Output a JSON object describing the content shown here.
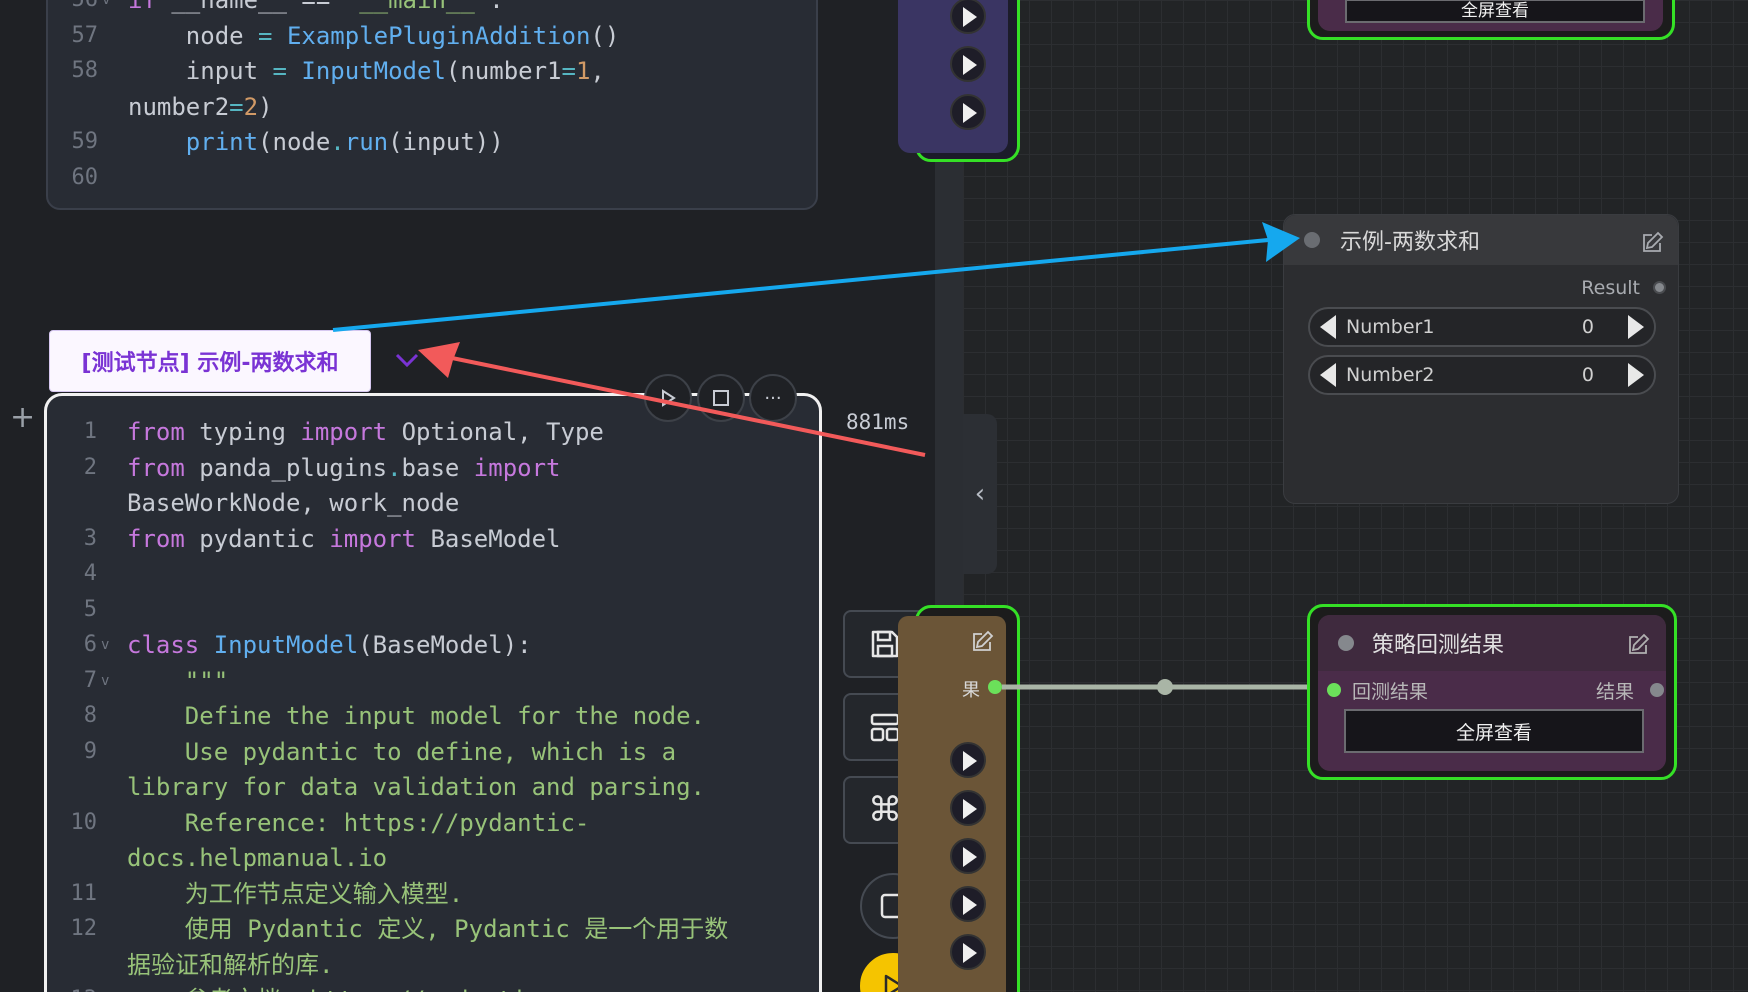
{
  "editor": {
    "top_cell_lines": [
      {
        "n": "56",
        "fold": "v",
        "parts": [
          [
            "kw",
            "if "
          ],
          [
            "plain",
            "__name__ == "
          ],
          [
            "str",
            "\"__main__\""
          ],
          [
            "plain",
            ":"
          ]
        ]
      },
      {
        "n": "57",
        "parts": [
          [
            "plain",
            "    node "
          ],
          [
            "op",
            "= "
          ],
          [
            "fn",
            "ExamplePluginAddition"
          ],
          [
            "plain",
            "()"
          ]
        ]
      },
      {
        "n": "58",
        "parts": [
          [
            "plain",
            "    input "
          ],
          [
            "op",
            "= "
          ],
          [
            "fn",
            "InputModel"
          ],
          [
            "plain",
            "(number1"
          ],
          [
            "op",
            "="
          ],
          [
            "num",
            "1"
          ],
          [
            "plain",
            ","
          ]
        ]
      },
      {
        "n": "",
        "parts": [
          [
            "plain",
            "number2"
          ],
          [
            "op",
            "="
          ],
          [
            "num",
            "2"
          ],
          [
            "plain",
            ")"
          ]
        ]
      },
      {
        "n": "59",
        "parts": [
          [
            "plain",
            "    "
          ],
          [
            "fn",
            "print"
          ],
          [
            "plain",
            "(node"
          ],
          [
            "op",
            "."
          ],
          [
            "fn",
            "run"
          ],
          [
            "plain",
            "(input))"
          ]
        ]
      },
      {
        "n": "60",
        "parts": []
      }
    ],
    "main_cell_lines": [
      {
        "n": "1",
        "parts": [
          [
            "kw",
            "from "
          ],
          [
            "plain",
            "typing "
          ],
          [
            "kw",
            "import "
          ],
          [
            "plain",
            "Optional, Type"
          ]
        ]
      },
      {
        "n": "2",
        "parts": [
          [
            "kw",
            "from "
          ],
          [
            "plain",
            "panda_plugins"
          ],
          [
            "op",
            "."
          ],
          [
            "plain",
            "base "
          ],
          [
            "kw",
            "import"
          ]
        ]
      },
      {
        "n": "",
        "parts": [
          [
            "plain",
            "BaseWorkNode, work_node"
          ]
        ]
      },
      {
        "n": "3",
        "parts": [
          [
            "kw",
            "from "
          ],
          [
            "plain",
            "pydantic "
          ],
          [
            "kw",
            "import "
          ],
          [
            "plain",
            "BaseModel"
          ]
        ]
      },
      {
        "n": "4",
        "parts": []
      },
      {
        "n": "5",
        "parts": []
      },
      {
        "n": "6",
        "fold": "v",
        "parts": [
          [
            "kw",
            "class "
          ],
          [
            "fn",
            "InputModel"
          ],
          [
            "plain",
            "(BaseModel):"
          ]
        ]
      },
      {
        "n": "7",
        "fold": "v",
        "parts": [
          [
            "str",
            "    \"\"\""
          ]
        ]
      },
      {
        "n": "8",
        "parts": [
          [
            "str",
            "    Define the input model for the node."
          ]
        ]
      },
      {
        "n": "9",
        "parts": [
          [
            "str",
            "    Use pydantic to define, which is a"
          ]
        ]
      },
      {
        "n": "",
        "parts": [
          [
            "str",
            "library for data validation and parsing."
          ]
        ]
      },
      {
        "n": "10",
        "parts": [
          [
            "str",
            "    Reference: https://pydantic-"
          ]
        ]
      },
      {
        "n": "",
        "parts": [
          [
            "str",
            "docs.helpmanual.io"
          ]
        ]
      },
      {
        "n": "11",
        "parts": [
          [
            "str",
            "    为工作节点定义输入模型."
          ]
        ]
      },
      {
        "n": "12",
        "parts": [
          [
            "str",
            "    使用 Pydantic 定义, Pydantic 是一个用于数"
          ]
        ]
      },
      {
        "n": "",
        "parts": [
          [
            "str",
            "据验证和解析的库."
          ]
        ]
      },
      {
        "n": "13",
        "parts": [
          [
            "str",
            "    参考文档: https://pydantic-"
          ]
        ]
      }
    ],
    "node_tab_label": "[测试节点] 示例-两数求和",
    "timing": "881ms",
    "icons": {
      "chevron": "chevron-down-icon",
      "run": "play-icon",
      "stop": "stop-icon",
      "more": "more-icon",
      "add": "plus-icon",
      "save": "save-icon",
      "layout": "layout-icon",
      "command": "command-icon",
      "stop_all": "stop-square-icon",
      "run_all": "play-icon"
    }
  },
  "canvas": {
    "sum_node": {
      "title": "示例-两数求和",
      "output_label": "Result",
      "fields": [
        {
          "label": "Number1",
          "value": "0"
        },
        {
          "label": "Number2",
          "value": "0"
        }
      ]
    },
    "backtest_node": {
      "title": "策略回测结果",
      "input_label": "回测结果",
      "output_label": "结果",
      "button": "全屏查看"
    },
    "top_node_button": "全屏查看",
    "left_stub_label": "果"
  },
  "colors": {
    "accent_purple": "#7a33d4",
    "node_border_green": "#35e026",
    "annotation_blue": "#15a8ee",
    "annotation_red": "#f25a5a",
    "run_yellow": "#f5c400"
  }
}
